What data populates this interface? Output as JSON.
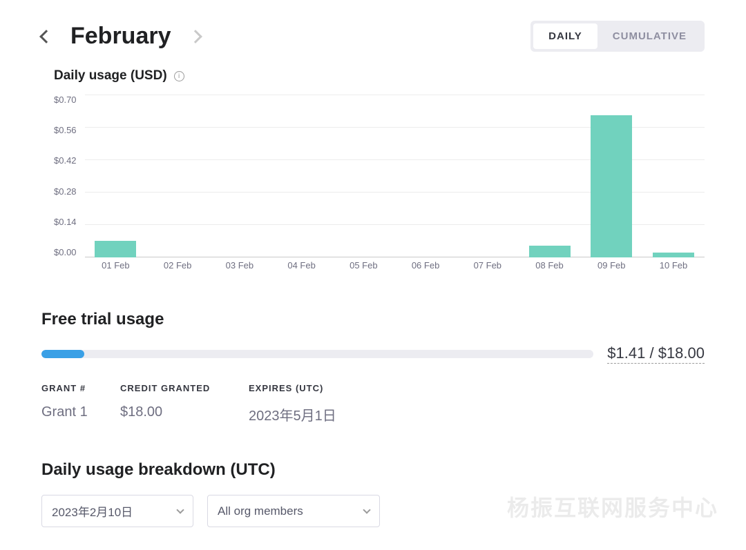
{
  "header": {
    "month": "February",
    "toggle": {
      "daily": "DAILY",
      "cumulative": "CUMULATIVE"
    }
  },
  "chart_title": "Daily usage (USD)",
  "chart_data": {
    "type": "bar",
    "title": "Daily usage (USD)",
    "xlabel": "",
    "ylabel": "",
    "ylim": [
      0,
      0.7
    ],
    "y_ticks": [
      "$0.70",
      "$0.56",
      "$0.42",
      "$0.28",
      "$0.14",
      "$0.00"
    ],
    "categories": [
      "01 Feb",
      "02 Feb",
      "03 Feb",
      "04 Feb",
      "05 Feb",
      "06 Feb",
      "07 Feb",
      "08 Feb",
      "09 Feb",
      "10 Feb"
    ],
    "values": [
      0.07,
      0.0,
      0.0,
      0.0,
      0.0,
      0.0,
      0.0,
      0.05,
      0.61,
      0.02
    ]
  },
  "free_trial": {
    "title": "Free trial usage",
    "used": "$1.41",
    "total": "$18.00",
    "percent": 7.8,
    "table": {
      "head_grant": "GRANT #",
      "head_credit": "CREDIT GRANTED",
      "head_expires": "EXPIRES (UTC)",
      "row": {
        "grant": "Grant 1",
        "credit": "$18.00",
        "expires": "2023年5月1日"
      }
    }
  },
  "breakdown": {
    "title": "Daily usage breakdown (UTC)",
    "date_select": "2023年2月10日",
    "member_select": "All org members"
  },
  "watermark": "杨振互联网服务中心"
}
